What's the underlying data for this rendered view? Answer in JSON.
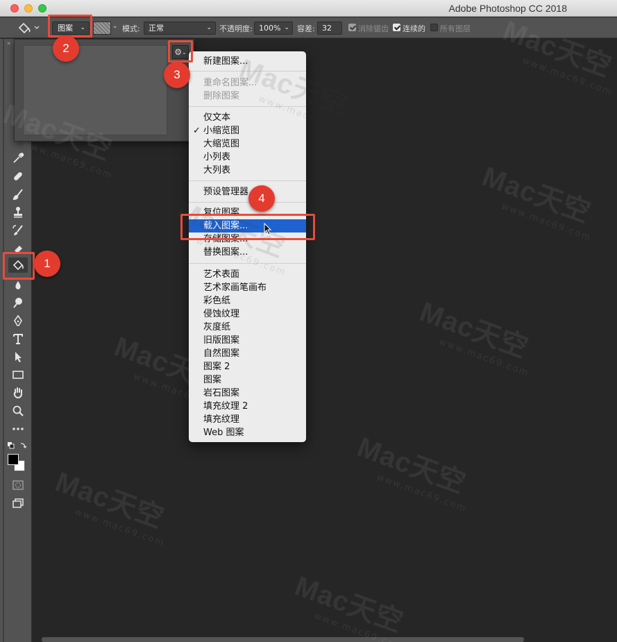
{
  "window": {
    "title": "Adobe Photoshop CC 2018"
  },
  "options_bar": {
    "fill_source": "图案",
    "mode_label": "模式:",
    "mode_value": "正常",
    "opacity_label": "不透明度:",
    "opacity_value": "100%",
    "tolerance_label": "容差:",
    "tolerance_value": "32",
    "anti_alias_label": "消除锯齿",
    "contiguous_label": "连续的",
    "all_layers_label": "所有图层"
  },
  "menu": {
    "items": [
      {
        "label": "新建图案...",
        "state": "normal"
      },
      {
        "label": "重命名图案...",
        "state": "disabled"
      },
      {
        "label": "删除图案",
        "state": "disabled"
      },
      {
        "label": "仅文本",
        "state": "normal"
      },
      {
        "label": "小缩览图",
        "state": "checked"
      },
      {
        "label": "大缩览图",
        "state": "normal"
      },
      {
        "label": "小列表",
        "state": "normal"
      },
      {
        "label": "大列表",
        "state": "normal"
      },
      {
        "label": "预设管理器...",
        "state": "normal"
      },
      {
        "label": "复位图案...",
        "state": "normal"
      },
      {
        "label": "载入图案...",
        "state": "selected"
      },
      {
        "label": "存储图案...",
        "state": "normal"
      },
      {
        "label": "替换图案...",
        "state": "normal"
      },
      {
        "label": "艺术表面",
        "state": "normal"
      },
      {
        "label": "艺术家画笔画布",
        "state": "normal"
      },
      {
        "label": "彩色纸",
        "state": "normal"
      },
      {
        "label": "侵蚀纹理",
        "state": "normal"
      },
      {
        "label": "灰度纸",
        "state": "normal"
      },
      {
        "label": "旧版图案",
        "state": "normal"
      },
      {
        "label": "自然图案",
        "state": "normal"
      },
      {
        "label": "图案 2",
        "state": "normal"
      },
      {
        "label": "图案",
        "state": "normal"
      },
      {
        "label": "岩石图案",
        "state": "normal"
      },
      {
        "label": "填充纹理 2",
        "state": "normal"
      },
      {
        "label": "填充纹理",
        "state": "normal"
      },
      {
        "label": "Web 图案",
        "state": "normal"
      }
    ],
    "check_mark": "✓"
  },
  "annotations": {
    "badge_1": "1",
    "badge_2": "2",
    "badge_3": "3",
    "badge_4": "4"
  },
  "watermark": {
    "main": "Mac天空",
    "sub": "www.mac69.com"
  },
  "colors": {
    "accent_highlight": "#e74c3c",
    "menu_selection": "#1e62d0",
    "foreground": "#000000",
    "background": "#ffffff"
  }
}
